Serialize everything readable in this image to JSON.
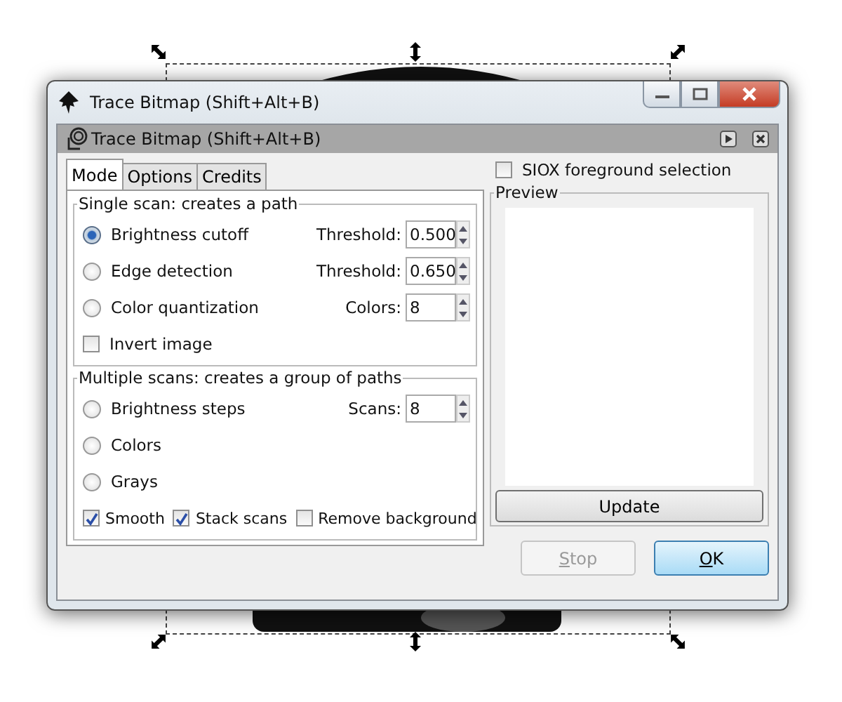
{
  "window": {
    "title": "Trace Bitmap (Shift+Alt+B)"
  },
  "panel": {
    "title": "Trace Bitmap (Shift+Alt+B)"
  },
  "tabs": [
    {
      "label": "Mode",
      "selected": true
    },
    {
      "label": "Options",
      "selected": false
    },
    {
      "label": "Credits",
      "selected": false
    }
  ],
  "single_scan": {
    "title": "Single scan: creates a path",
    "rows": [
      {
        "kind": "radio",
        "label": "Brightness cutoff",
        "selected": true,
        "field_label": "Threshold:",
        "value": "0.500"
      },
      {
        "kind": "radio",
        "label": "Edge detection",
        "selected": false,
        "field_label": "Threshold:",
        "value": "0.650"
      },
      {
        "kind": "radio",
        "label": "Color quantization",
        "selected": false,
        "field_label": "Colors:",
        "value": "8"
      },
      {
        "kind": "check",
        "label": "Invert image",
        "checked": false
      }
    ]
  },
  "multiple_scans": {
    "title": "Multiple scans: creates a group of paths",
    "rows": [
      {
        "kind": "radio",
        "label": "Brightness steps",
        "selected": false,
        "field_label": "Scans:",
        "value": "8"
      },
      {
        "kind": "radio",
        "label": "Colors",
        "selected": false
      },
      {
        "kind": "radio",
        "label": "Grays",
        "selected": false
      }
    ],
    "options": [
      {
        "label": "Smooth",
        "checked": true
      },
      {
        "label": "Stack scans",
        "checked": true
      },
      {
        "label": "Remove background",
        "checked": false
      }
    ]
  },
  "siox": {
    "label": "SIOX foreground selection",
    "checked": false
  },
  "preview": {
    "title": "Preview",
    "button": "Update"
  },
  "buttons": [
    {
      "label": "Stop",
      "disabled": true,
      "default": false
    },
    {
      "label": "OK",
      "disabled": false,
      "default": true
    }
  ]
}
